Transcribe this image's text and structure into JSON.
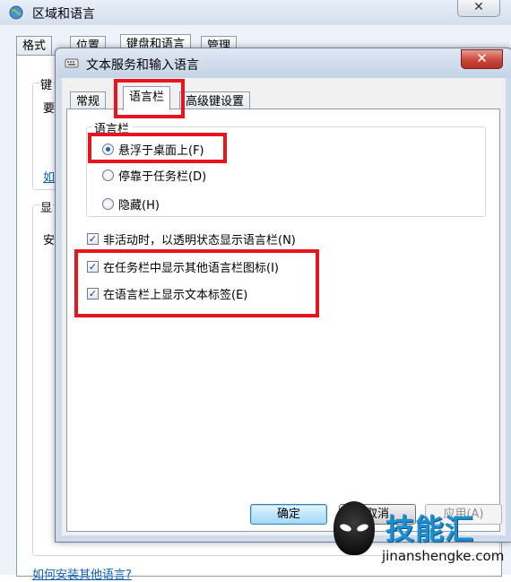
{
  "back_window": {
    "title": "区域和语言",
    "close_glyph": "✕",
    "tabs": [
      "格式",
      "位置",
      "键盘和语言",
      "管理"
    ],
    "fragments": {
      "keyboard_group": "键",
      "line_a": "要",
      "link_short": "如",
      "display_group": "显",
      "line_b": "安",
      "bottom_link": "如何安装其他语言?"
    }
  },
  "dialog": {
    "title": "文本服务和输入语言",
    "close_glyph": "✕",
    "tabs": [
      "常规",
      "语言栏",
      "高级键设置"
    ],
    "active_tab": "语言栏",
    "group_label": "语言栏",
    "radios": [
      {
        "label": "悬浮于桌面上(F)",
        "checked": true
      },
      {
        "label": "停靠于任务栏(D)",
        "checked": false
      },
      {
        "label": "隐藏(H)",
        "checked": false
      }
    ],
    "checkboxes": [
      {
        "label": "非活动时，以透明状态显示语言栏(N)",
        "checked": true
      },
      {
        "label": "在任务栏中显示其他语言栏图标(I)",
        "checked": true
      },
      {
        "label": "在语言栏上显示文本标签(E)",
        "checked": true
      }
    ],
    "buttons": {
      "ok": "确定",
      "cancel": "取消",
      "apply": "应用(A)"
    }
  },
  "watermark": {
    "text": "技能汇",
    "url": "jinanshengke.com"
  },
  "colors": {
    "highlight": "#e8151e",
    "dialog_close": "#c8483a",
    "link": "#0b5fb8"
  }
}
